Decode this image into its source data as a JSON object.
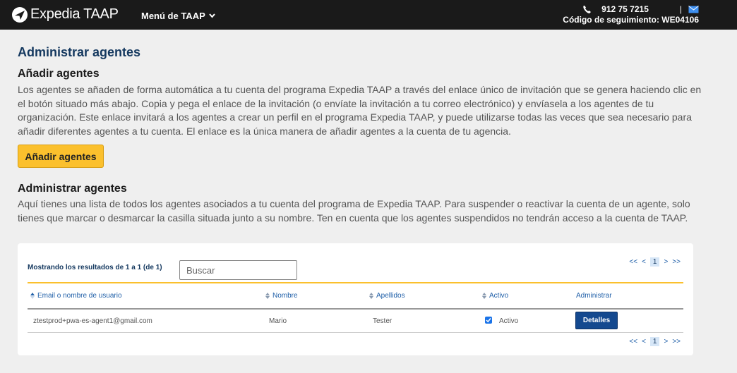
{
  "header": {
    "brand": "Expedia TAAP",
    "menu_label": "Menú de TAAP",
    "phone": "912 75 7215",
    "separator": "|",
    "tracking_label": "Código de seguimiento: WE04106"
  },
  "page": {
    "title": "Administrar agentes",
    "add_section": {
      "title": "Añadir agentes",
      "description": "Los agentes se añaden de forma automática a tu cuenta del programa Expedia TAAP a través del enlace único de invitación que se genera haciendo clic en el botón situado más abajo. Copia y pega el enlace de la invitación (o envíate la invitación a tu correo electrónico) y envíasela a los agentes de tu organización. Este enlace invitará a los agentes a crear un perfil en el programa Expedia TAAP, y puede utilizarse todas las veces que sea necesario para añadir diferentes agentes a tu cuenta. El enlace es la única manera de añadir agentes a la cuenta de tu agencia.",
      "button_label": "Añadir agentes"
    },
    "manage_section": {
      "title": "Administrar agentes",
      "description": "Aquí tienes una lista de todos los agentes asociados a tu cuenta del programa de Expedia TAAP. Para suspender o reactivar la cuenta de un agente, solo tienes que marcar o desmarcar la casilla situada junto a su nombre. Ten en cuenta que los agentes suspendidos no tendrán acceso a la cuenta de TAAP."
    }
  },
  "table": {
    "showing_text": "Mostrando los resultados de 1 a 1 (de 1)",
    "search_placeholder": "Buscar",
    "pager": {
      "first": "<<",
      "prev": "<",
      "current": "1",
      "next": ">",
      "last": ">>"
    },
    "columns": [
      "Email o nombre de usuario",
      "Nombre",
      "Apellidos",
      "Activo",
      "Administrar"
    ],
    "rows": [
      {
        "email": "ztestprod+pwa-es-agent1@gmail.com",
        "name": "Mario",
        "surname": "Tester",
        "active_label": "Activo",
        "active_checked": true,
        "action_label": "Detalles"
      }
    ]
  },
  "colors": {
    "accent_yellow": "#fbc02d",
    "title_blue": "#14385f",
    "link_blue": "#1f5fa8",
    "button_blue": "#14498f"
  },
  "icons": [
    "expedia-logo-icon",
    "chevron-down-icon",
    "phone-icon",
    "mail-icon",
    "sort-icon",
    "checkbox-checked-icon"
  ]
}
